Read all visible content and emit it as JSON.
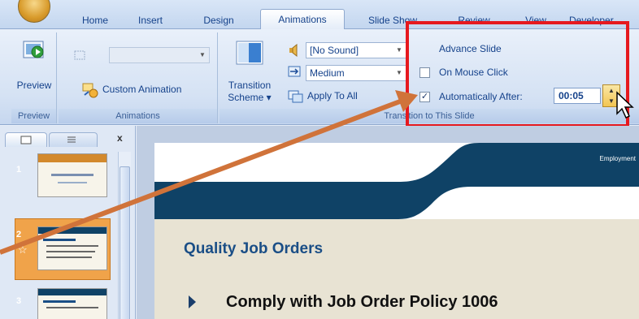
{
  "tabs": [
    "Home",
    "Insert",
    "Design",
    "Animations",
    "Slide Show",
    "Review",
    "View",
    "Developer"
  ],
  "active_tab": "Animations",
  "ribbon": {
    "preview_group": {
      "button_label": "Preview",
      "group_label": "Preview"
    },
    "animations_group": {
      "animate_value": "",
      "custom_animation_label": "Custom Animation",
      "group_label": "Animations"
    },
    "transition_group": {
      "scheme_label_1": "Transition",
      "scheme_label_2": "Scheme",
      "sound_value": "[No Sound]",
      "speed_value": "Medium",
      "apply_to_all_label": "Apply To All",
      "group_label": "Transition to This Slide"
    },
    "advance_slide": {
      "title": "Advance Slide",
      "on_mouse_click_label": "On Mouse Click",
      "on_mouse_click_checked": false,
      "auto_after_label": "Automatically After:",
      "auto_after_checked": true,
      "time_value": "00:05"
    }
  },
  "left_pane": {
    "close_glyph": "x",
    "slide_numbers": [
      "1",
      "2",
      "3"
    ],
    "selected_slide": "2",
    "star_glyph": "☆"
  },
  "slide": {
    "header_text": "Employment",
    "title": "Quality Job Orders",
    "bullet": "Comply with Job Order Policy 1006"
  },
  "colors": {
    "highlight_box": "#e6191f",
    "arrow": "#d0733a",
    "slide_band": "#0f4266",
    "slide_title": "#1a4e86"
  },
  "icons": [
    "preview-icon",
    "animate-icon",
    "custom-animation-icon",
    "transition-scheme-icon",
    "sound-icon",
    "speed-icon",
    "apply-to-all-icon",
    "mouse-cursor-icon",
    "annotation-arrow"
  ]
}
